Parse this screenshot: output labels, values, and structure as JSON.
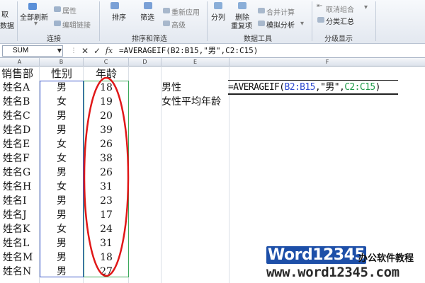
{
  "ribbon": {
    "left_stub": [
      "取",
      "数据"
    ],
    "refresh_all": "全部刷新",
    "properties": "属性",
    "edit_links": "编辑链接",
    "group_connections": "连接",
    "sort": "排序",
    "filter": "筛选",
    "reapply": "重新应用",
    "advanced": "高级",
    "group_sort_filter": "排序和筛选",
    "text_to_columns": "分列",
    "remove_duplicates": [
      "删除",
      "重复项"
    ],
    "consolidate": "合并计算",
    "what_if": "模拟分析",
    "group_data_tools": "数据工具",
    "ungroup": "取消组合",
    "subtotal": "分类汇总",
    "group_outline": "分级显示"
  },
  "formula_bar": {
    "name_box": "SUM",
    "cancel": "✕",
    "enter": "✓",
    "fx": "fx",
    "formula": "=AVERAGEIF(B2:B15,\"男\",C2:C15)"
  },
  "columns": [
    "A",
    "B",
    "C",
    "D",
    "E",
    "F"
  ],
  "table": {
    "headers": [
      "销售部",
      "性别",
      "年龄"
    ],
    "rows": [
      [
        "姓名A",
        "男",
        "18"
      ],
      [
        "姓名B",
        "女",
        "19"
      ],
      [
        "姓名C",
        "男",
        "20"
      ],
      [
        "姓名D",
        "男",
        "39"
      ],
      [
        "姓名E",
        "女",
        "26"
      ],
      [
        "姓名F",
        "女",
        "38"
      ],
      [
        "姓名G",
        "男",
        "26"
      ],
      [
        "姓名H",
        "女",
        "31"
      ],
      [
        "姓名I",
        "男",
        "23"
      ],
      [
        "姓名J",
        "男",
        "17"
      ],
      [
        "姓名K",
        "女",
        "24"
      ],
      [
        "姓名L",
        "男",
        "31"
      ],
      [
        "姓名M",
        "男",
        "18"
      ],
      [
        "姓名N",
        "男",
        "27"
      ]
    ]
  },
  "side": {
    "e2": "男性",
    "e3": "女性平均年龄",
    "edit_prefix": "=AVERAGEIF(",
    "edit_ref_b": "B2:B15",
    "edit_mid": ",\"男\",",
    "edit_ref_c": "C2:C15",
    "edit_suffix": ")"
  },
  "watermark": {
    "logo": "Word12345",
    "cn": "办公软件教程",
    "url": "www.word12345.com"
  },
  "colors": {
    "ref_b": "#2f4bd0",
    "ref_c": "#1f9a49",
    "annotation": "#e01818"
  }
}
